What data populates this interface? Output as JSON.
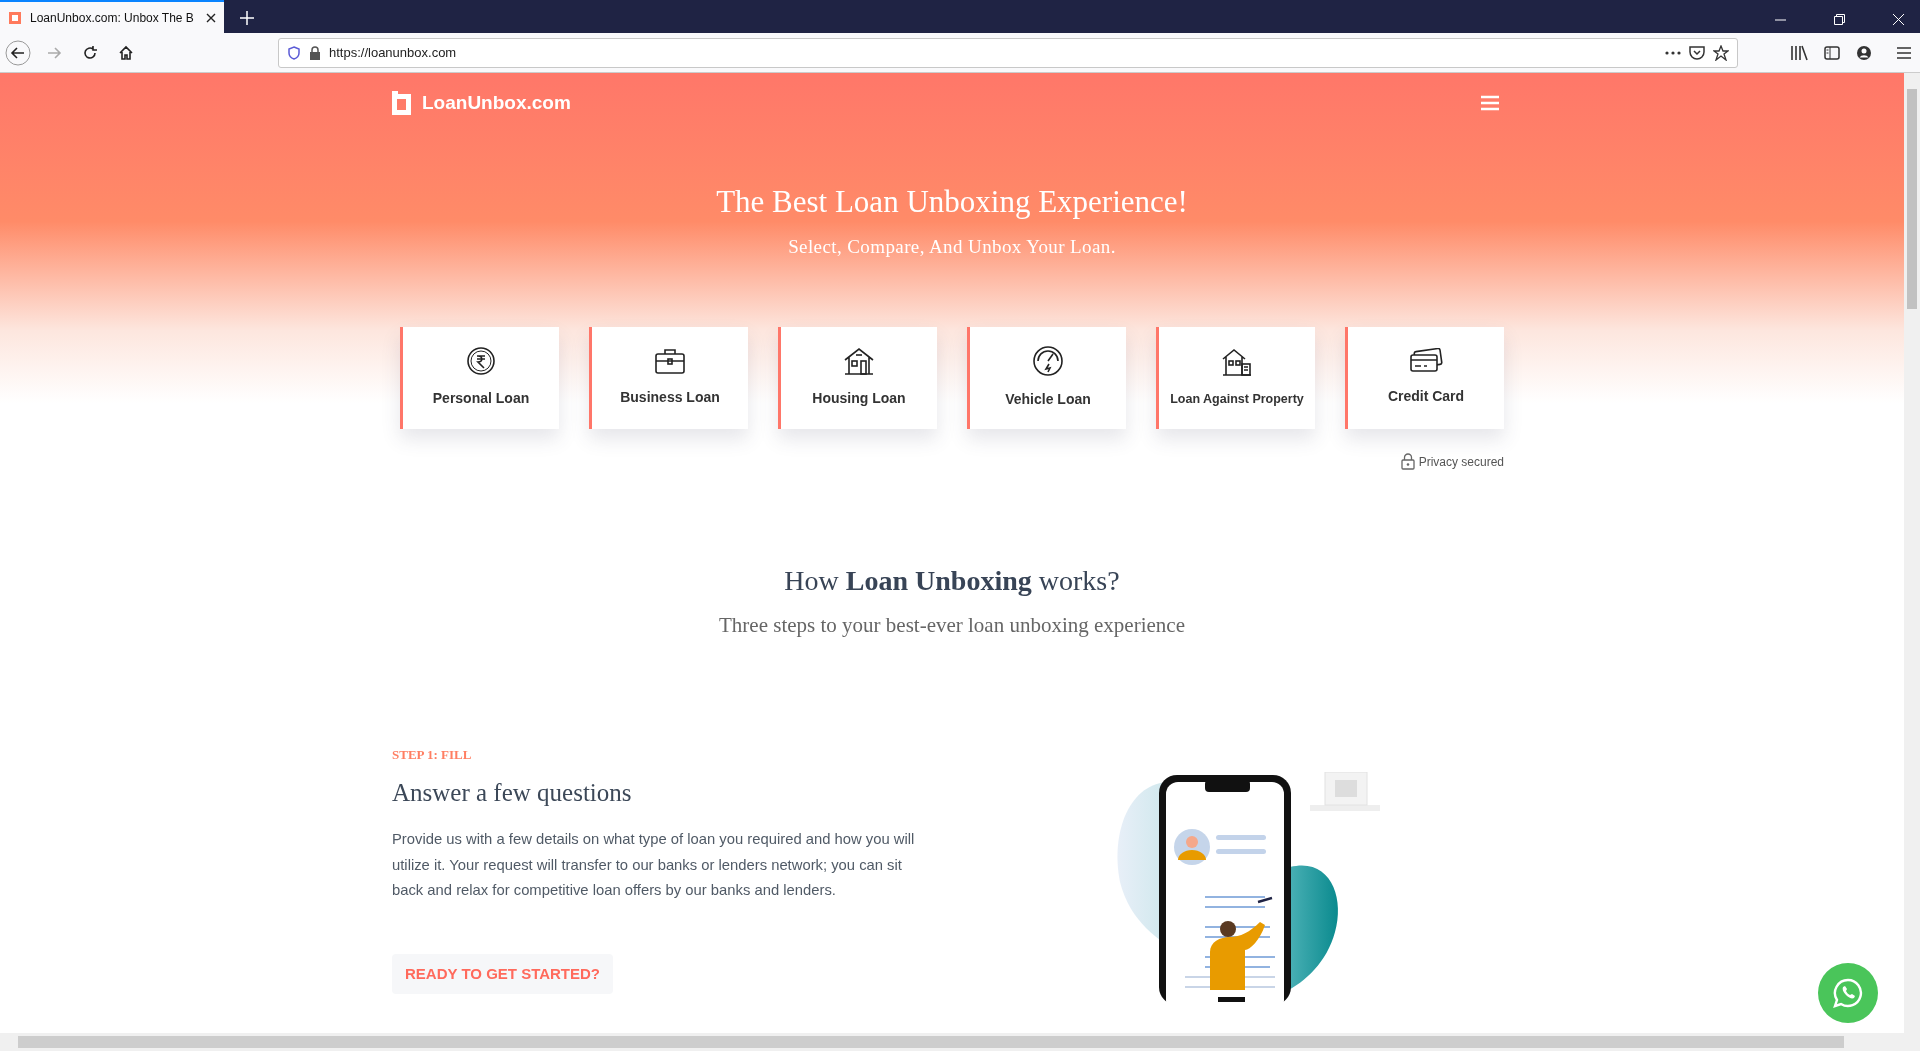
{
  "browser": {
    "tab_title": "LoanUnbox.com: Unbox The B",
    "url": "https://loanunbox.com"
  },
  "header": {
    "logo": "LoanUnbox.com"
  },
  "hero": {
    "title": "The Best Loan Unboxing Experience!",
    "subtitle": "Select, Compare, And Unbox Your Loan."
  },
  "products": [
    {
      "label": "Personal Loan",
      "kind": "rupee"
    },
    {
      "label": "Business Loan",
      "kind": "briefcase"
    },
    {
      "label": "Housing Loan",
      "kind": "house"
    },
    {
      "label": "Vehicle Loan",
      "kind": "gauge"
    },
    {
      "label": "Loan Against Property",
      "kind": "property"
    },
    {
      "label": "Credit Card",
      "kind": "card"
    }
  ],
  "privacy": "Privacy secured",
  "how": {
    "heading": "How **Loan Unboxing** works?",
    "subtitle": "Three steps to your best-ever loan unboxing experience"
  },
  "step": {
    "label": "STEP 1: FILL",
    "heading": "Answer a few questions",
    "text": "Provide us with a few details on what type of loan you required and how you will utilize it. Your request will transfer to our banks or lenders network; you can sit back and relax for competitive loan offers by our banks and lenders.",
    "button": "READY TO GET STARTED?"
  }
}
